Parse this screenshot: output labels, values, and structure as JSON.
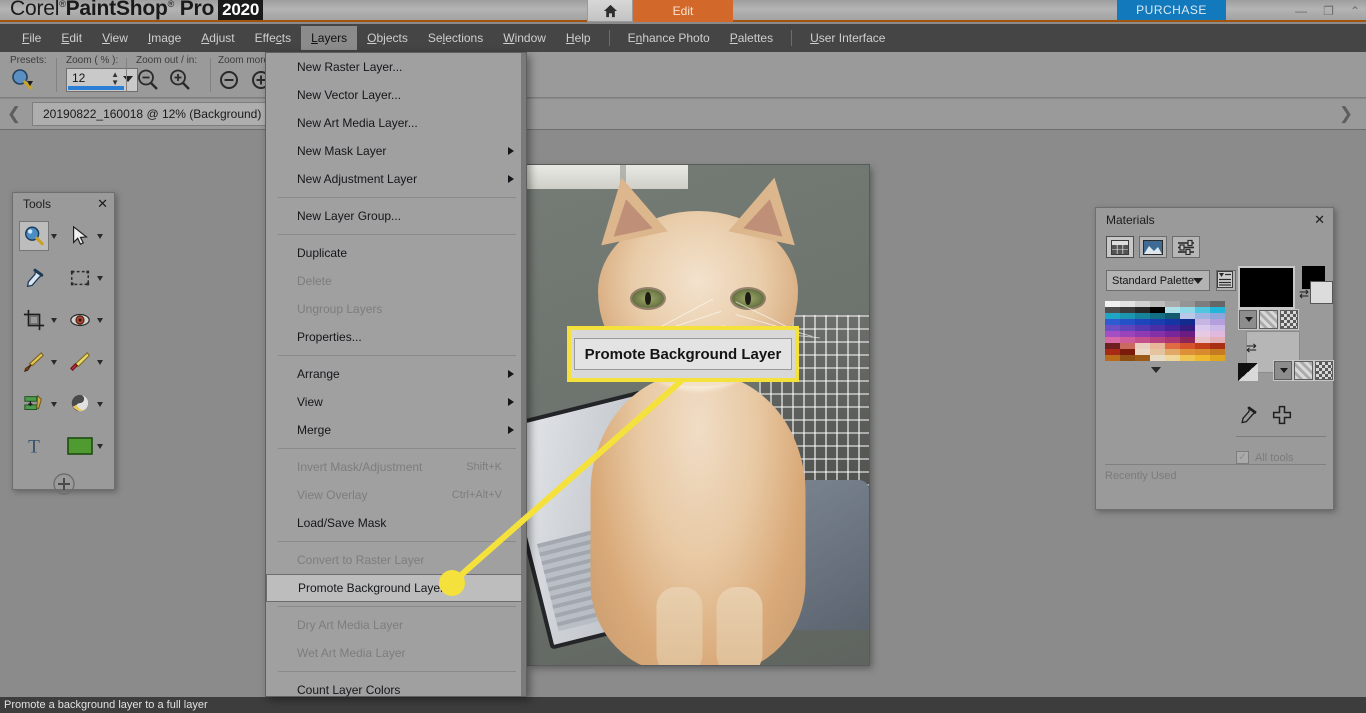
{
  "titlebar": {
    "brand_prefix": "Corel",
    "brand_main": "PaintShop",
    "brand_pro": "Pro",
    "brand_year": "2020",
    "home_icon": "home-icon",
    "edit_tab": "Edit",
    "purchase": "PURCHASE",
    "minimize": "minimize-icon",
    "restore": "restore-icon",
    "collapse": "chevron-up-icon"
  },
  "menubar": {
    "items": [
      {
        "label": "File"
      },
      {
        "label": "Edit"
      },
      {
        "label": "View"
      },
      {
        "label": "Image"
      },
      {
        "label": "Adjust"
      },
      {
        "label": "Effects"
      },
      {
        "label": "Layers",
        "active": true
      },
      {
        "label": "Objects"
      },
      {
        "label": "Selections"
      },
      {
        "label": "Window"
      },
      {
        "label": "Help"
      }
    ],
    "extras": [
      {
        "label": "Enhance Photo"
      },
      {
        "label": "Palettes"
      },
      {
        "label": "User Interface"
      }
    ]
  },
  "toolbar": {
    "presets_label": "Presets:",
    "zoom_label": "Zoom ( % ):",
    "zoom_value": "12",
    "zoom_out_in_label": "Zoom out / in:",
    "zoom_more_label": "Zoom more",
    "presets_icon": "zoom-preset-icon",
    "zoom_out_icon": "zoom-out-icon",
    "zoom_in_icon": "zoom-in-icon",
    "zoom_out_more_icon": "zoom-out-more-icon",
    "zoom_in_more_icon": "zoom-in-more-icon"
  },
  "tabstrip": {
    "prev_icon": "chevron-left-icon",
    "next_icon": "chevron-right-icon",
    "document_tab": "20190822_160018 @  12% (Background)",
    "close_icon": "close-icon"
  },
  "tools_palette": {
    "title": "Tools",
    "close_icon": "close-icon",
    "tools": [
      {
        "name": "zoom-tool",
        "icon": "magnifier-icon",
        "selected": true,
        "has_dropdown": true
      },
      {
        "name": "pick-tool",
        "icon": "arrow-cursor-icon",
        "selected": false,
        "has_dropdown": true
      },
      {
        "name": "dropper-tool",
        "icon": "eyedropper-icon",
        "selected": false,
        "has_dropdown": false
      },
      {
        "name": "selection-tool",
        "icon": "marquee-selection-icon",
        "selected": false,
        "has_dropdown": true
      },
      {
        "name": "crop-tool",
        "icon": "crop-icon",
        "selected": false,
        "has_dropdown": true
      },
      {
        "name": "red-eye-tool",
        "icon": "eye-icon",
        "selected": false,
        "has_dropdown": true
      },
      {
        "name": "paint-brush-tool",
        "icon": "paintbrush-icon",
        "selected": false,
        "has_dropdown": true
      },
      {
        "name": "eraser-tool",
        "icon": "eraser-icon",
        "selected": false,
        "has_dropdown": true
      },
      {
        "name": "clone-tool",
        "icon": "clone-brush-icon",
        "selected": false,
        "has_dropdown": true
      },
      {
        "name": "smudge-tool",
        "icon": "smudge-icon",
        "selected": false,
        "has_dropdown": true
      },
      {
        "name": "text-tool",
        "icon": "text-t-icon",
        "selected": false,
        "has_dropdown": false
      },
      {
        "name": "shape-tool",
        "icon": "rectangle-shape-icon",
        "selected": false,
        "has_dropdown": true
      }
    ],
    "more_icon": "add-circle-icon"
  },
  "materials_palette": {
    "title": "Materials",
    "close_icon": "close-icon",
    "tabs": [
      {
        "name": "swatches-tab",
        "icon": "grid-swatches-icon",
        "active": true
      },
      {
        "name": "rainbow-tab",
        "icon": "gradient-picker-icon",
        "active": false
      },
      {
        "name": "hsl-tab",
        "icon": "sliders-icon",
        "active": false
      }
    ],
    "palette_select": "Standard Palette",
    "palette_menu_icon": "list-menu-icon",
    "foreground_color": "#000000",
    "background_color": "#dcdcdc",
    "swap_icon": "swap-arrows-icon",
    "dropper_icon": "eyedropper-icon",
    "add_icon": "plus-icon",
    "all_tools_label": "All tools",
    "all_tools_checked": true,
    "recently_used_label": "Recently Used",
    "swatch_colors": [
      "#f2f2f2",
      "#e2e2e2",
      "#d0d0d0",
      "#bdbdbd",
      "#a9a9a9",
      "#949494",
      "#7d7d7d",
      "#666666",
      "#4f4f4f",
      "#3b3b3b",
      "#272727",
      "#000000",
      "#aee0ea",
      "#8ed8e8",
      "#52c6de",
      "#21b6d8",
      "#1fa6c4",
      "#1b95b0",
      "#16829b",
      "#136f86",
      "#14596d",
      "#b9c8e8",
      "#9fb3e0",
      "#8fa6da",
      "#2f5bd0",
      "#2450c8",
      "#1e46bc",
      "#1a3db0",
      "#1634a4",
      "#122b8e",
      "#c7b6e4",
      "#b49fdc",
      "#6b4fc4",
      "#6044bc",
      "#5539b2",
      "#4b2fa6",
      "#40269a",
      "#341d82",
      "#d9c9ec",
      "#cdb9e6",
      "#a44fc4",
      "#9a44bc",
      "#8f39b2",
      "#8430a6",
      "#78279a",
      "#6b1d82",
      "#e7c9e4",
      "#e0b9dc",
      "#d86aa8",
      "#cf5c9b",
      "#c44f8d",
      "#b8427f",
      "#a93670",
      "#8e2558",
      "#e8c3c8",
      "#e2b0b6",
      "#6d1f22",
      "#c86a5f",
      "#e8cfc0",
      "#e8b79a",
      "#e06a42",
      "#d4532c",
      "#c23f1c",
      "#a92f12",
      "#a82a14",
      "#7a1b0c",
      "#e9d9c6",
      "#e4c49e",
      "#e2a868",
      "#dd9038",
      "#d88a2e",
      "#c67a22",
      "#b96d1c",
      "#8d4f12",
      "#9c5a16",
      "#e9dcc4",
      "#efd79a",
      "#f0c450",
      "#eeb92f",
      "#e0a61f"
    ]
  },
  "layers_menu": {
    "groups": [
      {
        "items": [
          {
            "label": "New Raster Layer...",
            "disabled": false,
            "submenu": false,
            "accel": ""
          },
          {
            "label": "New Vector Layer...",
            "disabled": false,
            "submenu": false,
            "accel": ""
          },
          {
            "label": "New Art Media Layer...",
            "disabled": false,
            "submenu": false,
            "accel": ""
          },
          {
            "label": "New Mask Layer",
            "disabled": false,
            "submenu": true,
            "accel": ""
          },
          {
            "label": "New Adjustment Layer",
            "disabled": false,
            "submenu": true,
            "accel": ""
          }
        ]
      },
      {
        "items": [
          {
            "label": "New Layer Group...",
            "disabled": false,
            "submenu": false,
            "accel": ""
          }
        ]
      },
      {
        "items": [
          {
            "label": "Duplicate",
            "disabled": false,
            "submenu": false,
            "accel": ""
          },
          {
            "label": "Delete",
            "disabled": true,
            "submenu": false,
            "accel": ""
          },
          {
            "label": "Ungroup Layers",
            "disabled": true,
            "submenu": false,
            "accel": ""
          },
          {
            "label": "Properties...",
            "disabled": false,
            "submenu": false,
            "accel": ""
          }
        ]
      },
      {
        "items": [
          {
            "label": "Arrange",
            "disabled": false,
            "submenu": true,
            "accel": ""
          },
          {
            "label": "View",
            "disabled": false,
            "submenu": true,
            "accel": ""
          },
          {
            "label": "Merge",
            "disabled": false,
            "submenu": true,
            "accel": ""
          }
        ]
      },
      {
        "items": [
          {
            "label": "Invert Mask/Adjustment",
            "disabled": true,
            "submenu": false,
            "accel": "Shift+K"
          },
          {
            "label": "View Overlay",
            "disabled": true,
            "submenu": false,
            "accel": "Ctrl+Alt+V"
          },
          {
            "label": "Load/Save Mask",
            "disabled": false,
            "submenu": false,
            "accel": ""
          }
        ]
      },
      {
        "items": [
          {
            "label": "Convert to Raster Layer",
            "disabled": true,
            "submenu": false,
            "accel": ""
          },
          {
            "label": "Promote Background Layer",
            "disabled": false,
            "submenu": false,
            "accel": "",
            "highlighted": true
          }
        ]
      },
      {
        "items": [
          {
            "label": "Dry Art Media Layer",
            "disabled": true,
            "submenu": false,
            "accel": ""
          },
          {
            "label": "Wet Art Media Layer",
            "disabled": true,
            "submenu": false,
            "accel": ""
          }
        ]
      },
      {
        "items": [
          {
            "label": "Count Layer Colors",
            "disabled": false,
            "submenu": false,
            "accel": ""
          }
        ]
      }
    ]
  },
  "callout": {
    "text": "Promote Background Layer",
    "highlight_color": "#f5e13c"
  },
  "statusbar": {
    "text": "Promote a background layer to a full layer"
  }
}
